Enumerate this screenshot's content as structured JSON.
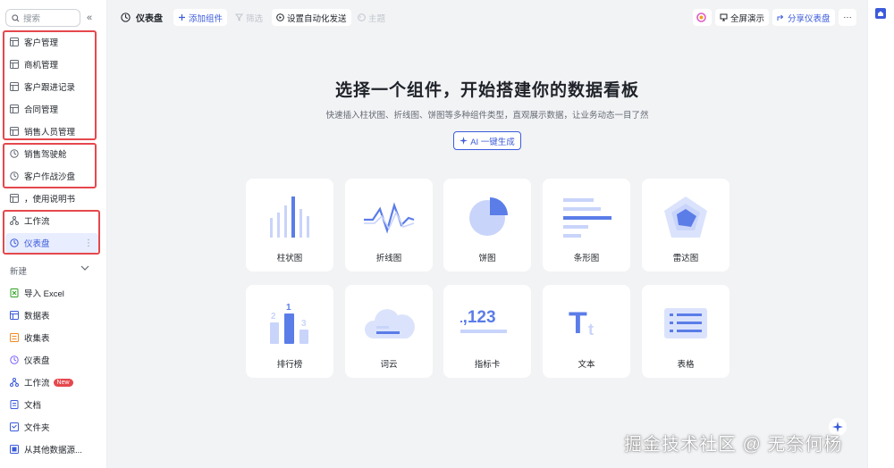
{
  "sidebar": {
    "search_placeholder": "搜索",
    "collapse_glyph": "«",
    "items": [
      {
        "label": "客户管理",
        "icon": "table-icon"
      },
      {
        "label": "商机管理",
        "icon": "table-icon"
      },
      {
        "label": "客户跟进记录",
        "icon": "table-icon"
      },
      {
        "label": "合同管理",
        "icon": "table-icon"
      },
      {
        "label": "销售人员管理",
        "icon": "table-icon"
      },
      {
        "label": "销售驾驶舱",
        "icon": "dashboard-icon"
      },
      {
        "label": "客户作战沙盘",
        "icon": "dashboard-icon"
      },
      {
        "label": "，使用说明书",
        "icon": "doc-icon"
      },
      {
        "label": "工作流",
        "icon": "workflow-icon"
      },
      {
        "label": "仪表盘",
        "icon": "dashboard-icon",
        "active": true
      }
    ],
    "more_glyph": "⋮",
    "new_section": {
      "title": "新建",
      "items": [
        {
          "label": "导入 Excel",
          "icon": "excel-icon"
        },
        {
          "label": "数据表",
          "icon": "table-icon"
        },
        {
          "label": "收集表",
          "icon": "form-icon"
        },
        {
          "label": "仪表盘",
          "icon": "dashboard-icon"
        },
        {
          "label": "工作流",
          "icon": "workflow-icon",
          "badge": "New"
        },
        {
          "label": "文档",
          "icon": "doc-icon"
        },
        {
          "label": "文件夹",
          "icon": "folder-icon"
        },
        {
          "label": "从其他数据源...",
          "icon": "datasource-icon"
        }
      ]
    }
  },
  "toolbar": {
    "title": "仪表盘",
    "add_component": "添加组件",
    "filter": "筛选",
    "auto_send": "设置自动化发送",
    "theme": "主题",
    "fullscreen": "全屏演示",
    "share": "分享仪表盘",
    "more": "···"
  },
  "hero": {
    "title": "选择一个组件，开始搭建你的数据看板",
    "subtitle": "快速插入柱状图、折线图、饼图等多种组件类型，直观展示数据，让业务动态一目了然",
    "ai_button": "AI 一键生成"
  },
  "components": [
    {
      "label": "柱状图",
      "icon": "bar-chart-icon"
    },
    {
      "label": "折线图",
      "icon": "line-chart-icon"
    },
    {
      "label": "饼图",
      "icon": "pie-chart-icon"
    },
    {
      "label": "条形图",
      "icon": "horizontal-bar-icon"
    },
    {
      "label": "雷达图",
      "icon": "radar-chart-icon"
    },
    {
      "label": "排行榜",
      "icon": "ranking-icon",
      "digits": [
        "2",
        "1",
        "3"
      ]
    },
    {
      "label": "词云",
      "icon": "word-cloud-icon"
    },
    {
      "label": "指标卡",
      "icon": "metric-card-icon",
      "value": "1,123"
    },
    {
      "label": "文本",
      "icon": "text-icon",
      "glyph": "T",
      "glyph_small": "t"
    },
    {
      "label": "表格",
      "icon": "table-grid-icon"
    }
  ],
  "watermark": "掘金技术社区 @ 无奈何杨",
  "colors": {
    "accent": "#3b5bdb",
    "icon_blue": "#5b7de8",
    "icon_light": "#c9d4fa",
    "highlight": "#e5484d"
  }
}
